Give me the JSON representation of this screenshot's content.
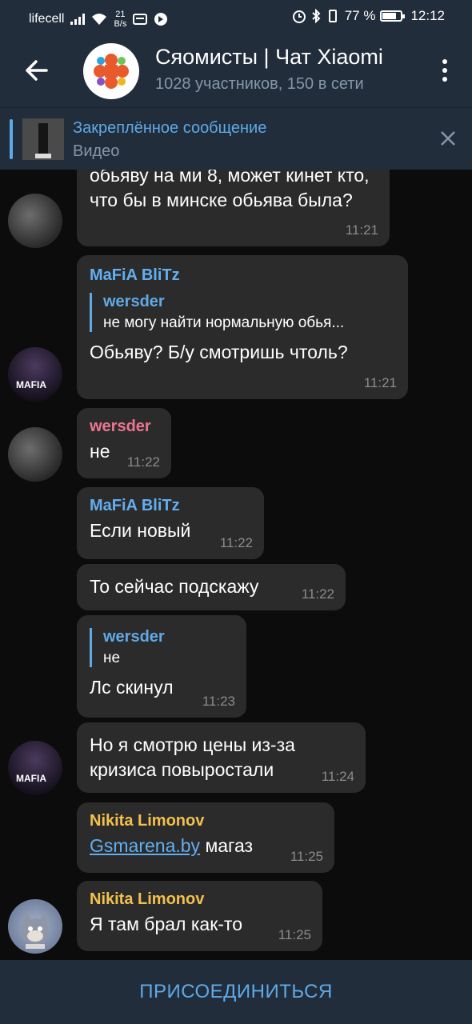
{
  "status": {
    "carrier": "lifecell",
    "speed_value": "21",
    "speed_unit": "B/s",
    "battery": "77 %",
    "battery_level": 0.77,
    "time": "12:12"
  },
  "header": {
    "title": "Сяомисты | Чат Xiaomi",
    "subtitle": "1028 участников, 150 в сети"
  },
  "pinned": {
    "title": "Закреплённое сообщение",
    "text": "Видео"
  },
  "messages": [
    {
      "text": "обьяву на ми 8, может кинет кто, что бы в минске обьява была?",
      "time": "11:21"
    },
    {
      "sender": "MaFiA BliTz",
      "quote_name": "wersder",
      "quote_text": "не могу найти нормальную обья...",
      "text": "Обьяву? Б/у смотришь чтоль?",
      "time": "11:21"
    },
    {
      "sender": "wersder",
      "text": "не",
      "time": "11:22"
    },
    {
      "sender": "MaFiA BliTz",
      "text": "Если новый",
      "time": "11:22"
    },
    {
      "text": "То сейчас подскажу",
      "time": "11:22"
    },
    {
      "quote_name": "wersder",
      "quote_text": "не",
      "text": "Лс скинул",
      "time": "11:23"
    },
    {
      "text": "Но я смотрю цены из-за кризиса повыростали",
      "time": "11:24"
    },
    {
      "sender": "Nikita Limonov",
      "link": "Gsmarena.by",
      "text": " магаз",
      "time": "11:25"
    },
    {
      "sender": "Nikita Limonov",
      "text": "Я там брал как-то",
      "time": "11:25"
    }
  ],
  "avatars": {
    "mafia_label": "MAFIA"
  },
  "join_label": "ПРИСОЕДИНИТЬСЯ",
  "colors": {
    "bar_bg": "#212d3b",
    "accent": "#5fa9e6",
    "sender_mafia": "#62aef0",
    "sender_wersder": "#ee7591",
    "sender_nikita": "#f2c14e",
    "bubble": "#2b2b2b"
  }
}
